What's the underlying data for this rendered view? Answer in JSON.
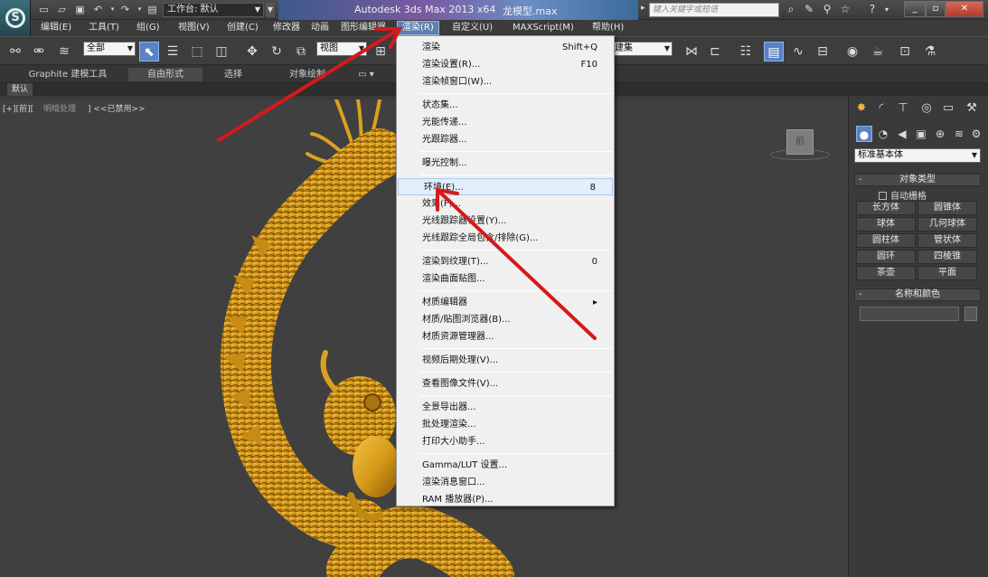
{
  "titlebar": {
    "app": "Autodesk 3ds Max  2013 x64",
    "file": "龙模型.max",
    "workspace": "工作台: 默认",
    "search_placeholder": "键入关键字或短语"
  },
  "menus": [
    "编辑(E)",
    "工具(T)",
    "组(G)",
    "视图(V)",
    "创建(C)",
    "修改器",
    "动画",
    "图形编辑器",
    "渲染(R)",
    "自定义(U)",
    "MAXScript(M)",
    "帮助(H)"
  ],
  "toolbar": {
    "selection_filter": "全部",
    "ref_coord": "视图",
    "named_selection": "建集"
  },
  "ribbon": {
    "tabs": [
      "Graphite 建模工具",
      "自由形式",
      "选择",
      "对象绘制"
    ],
    "sub_tab": "默认"
  },
  "viewport": {
    "label": "[+][前][",
    "label_shading": "明暗处理",
    "label_end": "]",
    "label_disabled": "<<已禁用>>",
    "viewcube": "前"
  },
  "cmdpanel": {
    "category": "标准基本体",
    "object_type": "对象类型",
    "autogrid": "自动栅格",
    "primitives": [
      "长方体",
      "圆锥体",
      "球体",
      "几何球体",
      "圆柱体",
      "管状体",
      "圆环",
      "四棱锥",
      "茶壶",
      "平面"
    ],
    "name_color": "名称和颜色"
  },
  "render_menu": {
    "groups": [
      [
        {
          "label": "渲染",
          "shortcut": "Shift+Q"
        },
        {
          "label": "渲染设置(R)...",
          "shortcut": "F10"
        },
        {
          "label": "渲染帧窗口(W)...",
          "shortcut": ""
        }
      ],
      [
        {
          "label": "状态集...",
          "shortcut": ""
        },
        {
          "label": "光能传递...",
          "shortcut": ""
        },
        {
          "label": "光跟踪器...",
          "shortcut": ""
        }
      ],
      [
        {
          "label": "曝光控制...",
          "shortcut": ""
        }
      ],
      [
        {
          "label": "环境(E)...",
          "shortcut": "8"
        },
        {
          "label": "效果(F)...",
          "shortcut": ""
        },
        {
          "label": "光线跟踪器设置(Y)...",
          "shortcut": ""
        },
        {
          "label": "光线跟踪全局包含/排除(G)...",
          "shortcut": ""
        }
      ],
      [
        {
          "label": "渲染到纹理(T)...",
          "shortcut": "0"
        },
        {
          "label": "渲染曲面贴图...",
          "shortcut": ""
        }
      ],
      [
        {
          "label": "材质编辑器",
          "shortcut": "▸"
        },
        {
          "label": "材质/贴图浏览器(B)...",
          "shortcut": ""
        },
        {
          "label": "材质资源管理器...",
          "shortcut": ""
        }
      ],
      [
        {
          "label": "视频后期处理(V)...",
          "shortcut": ""
        }
      ],
      [
        {
          "label": "查看图像文件(V)...",
          "shortcut": ""
        }
      ],
      [
        {
          "label": "全景导出器...",
          "shortcut": ""
        },
        {
          "label": "批处理渲染...",
          "shortcut": ""
        },
        {
          "label": "打印大小助手...",
          "shortcut": ""
        }
      ],
      [
        {
          "label": "Gamma/LUT 设置...",
          "shortcut": ""
        },
        {
          "label": "渲染消息窗口...",
          "shortcut": ""
        },
        {
          "label": "RAM 播放器(P)...",
          "shortcut": ""
        }
      ]
    ]
  },
  "colors": {
    "accent": "#5b82c4",
    "annotation": "#d41a1a",
    "dragon": "#d9a21e"
  }
}
